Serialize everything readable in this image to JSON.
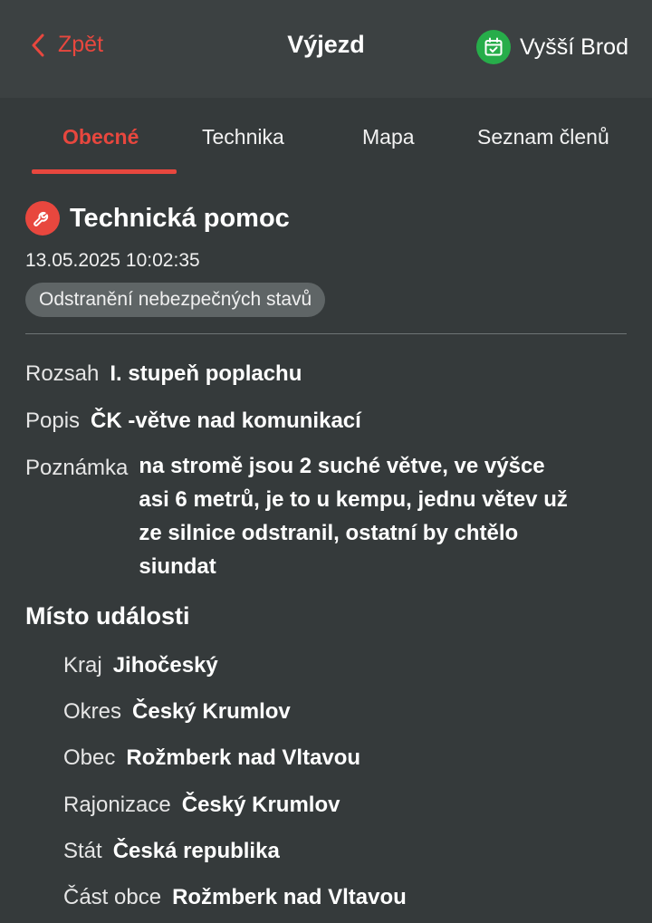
{
  "header": {
    "back_label": "Zpět",
    "title": "Výjezd",
    "station": "Vyšší Brod",
    "accent_color": "#e8473e",
    "station_icon_color": "#27ad4a"
  },
  "tabs": [
    {
      "label": "Obecné",
      "active": true
    },
    {
      "label": "Technika",
      "active": false
    },
    {
      "label": "Mapa",
      "active": false
    },
    {
      "label": "Seznam členů",
      "active": false
    }
  ],
  "event": {
    "icon": "wrench-icon",
    "title": "Technická pomoc",
    "datetime": "13.05.2025 10:02:35",
    "category": "Odstranění nebezpečných stavů"
  },
  "details": {
    "rozsah": {
      "label": "Rozsah",
      "value": "I. stupeň poplachu"
    },
    "popis": {
      "label": "Popis",
      "value": "ČK -větve nad komunikací"
    },
    "poznamka": {
      "label": "Poznámka",
      "value": "na stromě jsou 2 suché větve,  ve výšce asi 6 metrů, je to u kempu, jednu větev už ze silnice odstranil, ostatní by chtělo siundat"
    }
  },
  "location": {
    "title": "Místo události",
    "kraj": {
      "label": "Kraj",
      "value": "Jihočeský"
    },
    "okres": {
      "label": "Okres",
      "value": "Český Krumlov"
    },
    "obec": {
      "label": "Obec",
      "value": "Rožmberk nad Vltavou"
    },
    "rajonizace": {
      "label": "Rajonizace",
      "value": "Český Krumlov"
    },
    "stat": {
      "label": "Stát",
      "value": "Česká republika"
    },
    "cast_obce": {
      "label": "Část obce",
      "value": "Rožmberk nad Vltavou"
    }
  }
}
